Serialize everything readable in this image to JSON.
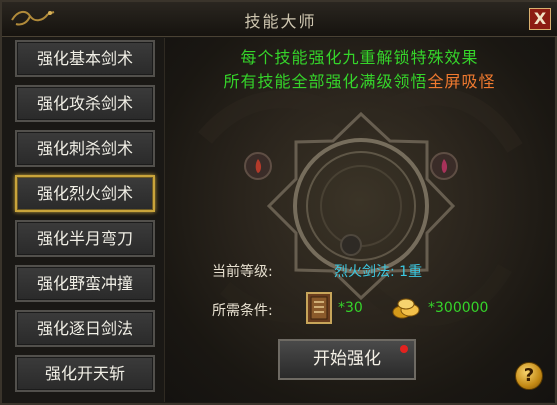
{
  "window": {
    "title": "技能大师",
    "close_label": "X"
  },
  "skills": [
    {
      "label": "强化基本剑术",
      "active": false
    },
    {
      "label": "强化攻杀剑术",
      "active": false
    },
    {
      "label": "强化刺杀剑术",
      "active": false
    },
    {
      "label": "强化烈火剑术",
      "active": true
    },
    {
      "label": "强化半月弯刀",
      "active": false
    },
    {
      "label": "强化野蛮冲撞",
      "active": false
    },
    {
      "label": "强化逐日剑法",
      "active": false
    },
    {
      "label": "强化开天斩",
      "active": false
    }
  ],
  "notice": {
    "line1": "每个技能强化九重解锁特殊效果",
    "line2_prefix": "所有技能全部强化满级领悟",
    "line2_highlight": "全屏吸怪"
  },
  "info": {
    "current_level_label": "当前等级:",
    "current_level_value": "烈火剑法: 1重",
    "requirements_label": "所需条件:",
    "req_item_count": "*30",
    "req_gold_count": "*300000"
  },
  "actions": {
    "start_label": "开始强化",
    "help_label": "?"
  },
  "colors": {
    "notice_green": "#35d42a",
    "highlight_orange": "#f07a2f",
    "level_cyan": "#3cc7e0",
    "req_green": "#35d42a"
  },
  "icons": {
    "title_ornament": "dragon-ornament-icon",
    "requirement_item": "skill-book-icon",
    "requirement_gold": "gold-ingot-icon",
    "help": "question-icon",
    "start_badge": "red-notification-dot"
  }
}
